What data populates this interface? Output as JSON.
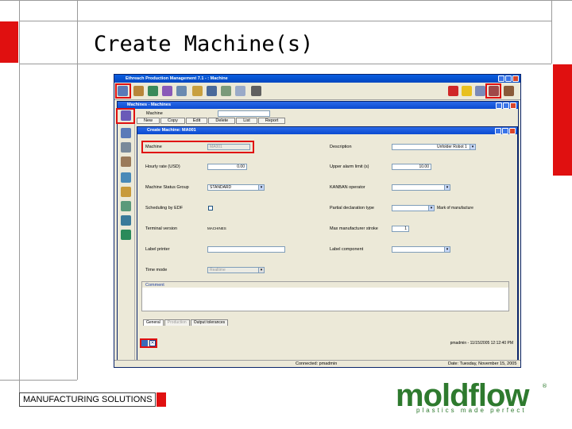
{
  "slide": {
    "title": "Create Machine(s)",
    "footer_label": "MANUFACTURING SOLUTIONS",
    "logo_word": "moldflow",
    "logo_tagline": "plastics made perfect",
    "logo_mark": "®",
    "accent_color": "#e01010",
    "logo_color": "#2e7a2e"
  },
  "app": {
    "main_title": "Ethreach Production Management 7.1 - : Machine",
    "child_title": "Machines - Machines",
    "form_title": "Create Machine: MA001",
    "search_label": "Machine",
    "actions": [
      "New",
      "Copy",
      "Edit",
      "Delete",
      "List",
      "Report"
    ],
    "fields_left": [
      {
        "label": "Machine",
        "value": "MA001",
        "kind": "disabled"
      },
      {
        "label": "Hourly rate (USD)",
        "value": "0.00",
        "kind": "text-right"
      },
      {
        "label": "Machine Status Group",
        "value": "STANDARD",
        "kind": "select"
      },
      {
        "label": "Scheduling by EDF",
        "value": "",
        "kind": "checkbox"
      },
      {
        "label": "Terminal version",
        "value": "MACHINES",
        "kind": "static"
      },
      {
        "label": "Label printer",
        "value": "",
        "kind": "text"
      },
      {
        "label": "Time mode",
        "value": "Realtime",
        "kind": "disabled-select"
      }
    ],
    "fields_right": [
      {
        "label": "Description",
        "value": "Unfolder Robot 1",
        "kind": "select"
      },
      {
        "label": "Upper alarm limit (s)",
        "value": "10.00",
        "kind": "text-right"
      },
      {
        "label": "KANBAN operator",
        "value": "",
        "kind": "select"
      },
      {
        "label": "Partial declaration type",
        "value": "",
        "kind": "select",
        "extra": "Mark of manufacture"
      },
      {
        "label": "Max manufacturer stroke",
        "value": "1",
        "kind": "text-right-small"
      },
      {
        "label": "Label component",
        "value": "",
        "kind": "select"
      }
    ],
    "comment_label": "Comment",
    "subtabs": [
      "General",
      "Production",
      "Output tolerances"
    ],
    "status_right": "pmadmin - 11/15/2005 12:12:40 PM",
    "bottom_connected": "Connected: pmadmin",
    "bottom_date": "Date: Tuesday, November 15, 2005"
  }
}
